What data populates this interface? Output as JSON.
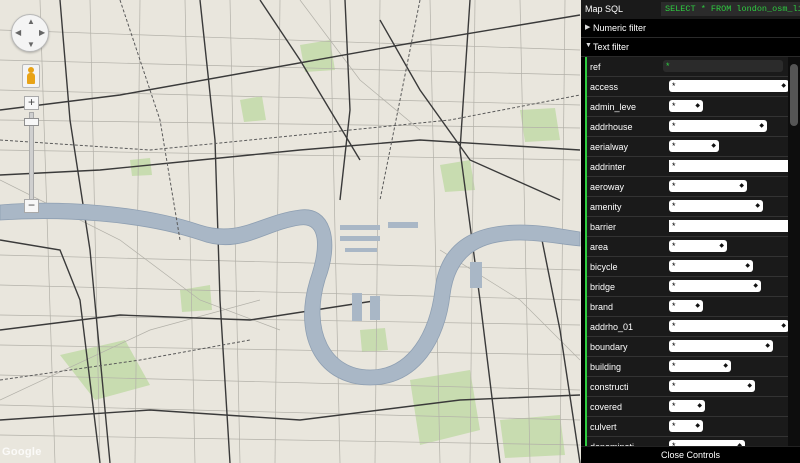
{
  "map": {
    "logo": "Google",
    "controls": {
      "zoom_in": "+",
      "zoom_out": "−",
      "pan_icon": "pan-arrows-icon",
      "streetview_icon": "pegman-icon"
    },
    "colors": {
      "land": "#e9e6dd",
      "water": "#a9b7c6",
      "park": "#c8dcb0",
      "road_major": "#3a3a3a",
      "road_minor": "#9c9c9c"
    }
  },
  "panel": {
    "sql_label": "Map SQL",
    "sql_value": "SELECT * FROM london_osm_line",
    "numeric_filter": "Numeric filter",
    "text_filter": "Text filter",
    "close_label": "Close Controls",
    "accent": "#2ecc40",
    "filters": [
      {
        "name": "ref",
        "value": "*",
        "kind": "dark",
        "w": 0
      },
      {
        "name": "access",
        "value": "*",
        "kind": "select",
        "w": 120
      },
      {
        "name": "admin_leve",
        "value": "*",
        "kind": "select",
        "w": 34
      },
      {
        "name": "addrhouse",
        "value": "*",
        "kind": "select",
        "w": 98
      },
      {
        "name": "aerialway",
        "value": "*",
        "kind": "select",
        "w": 50
      },
      {
        "name": "addrinter",
        "value": "*",
        "kind": "text",
        "w": 120
      },
      {
        "name": "aeroway",
        "value": "*",
        "kind": "select",
        "w": 78
      },
      {
        "name": "amenity",
        "value": "*",
        "kind": "select",
        "w": 94
      },
      {
        "name": "barrier",
        "value": "*",
        "kind": "text",
        "w": 120
      },
      {
        "name": "area",
        "value": "*",
        "kind": "select",
        "w": 58
      },
      {
        "name": "bicycle",
        "value": "*",
        "kind": "select",
        "w": 84
      },
      {
        "name": "bridge",
        "value": "*",
        "kind": "select",
        "w": 92
      },
      {
        "name": "brand",
        "value": "*",
        "kind": "select",
        "w": 34
      },
      {
        "name": "addrho_01",
        "value": "*",
        "kind": "select",
        "w": 120
      },
      {
        "name": "boundary",
        "value": "*",
        "kind": "select",
        "w": 104
      },
      {
        "name": "building",
        "value": "*",
        "kind": "select",
        "w": 62
      },
      {
        "name": "constructi",
        "value": "*",
        "kind": "select",
        "w": 86
      },
      {
        "name": "covered",
        "value": "*",
        "kind": "select",
        "w": 36
      },
      {
        "name": "culvert",
        "value": "*",
        "kind": "select",
        "w": 34
      },
      {
        "name": "denominati",
        "value": "*",
        "kind": "select",
        "w": 76
      },
      {
        "name": "",
        "value": "*",
        "kind": "select",
        "w": 34
      }
    ]
  }
}
